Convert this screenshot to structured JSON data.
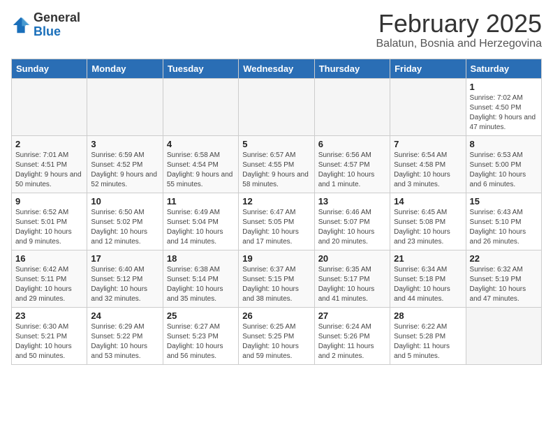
{
  "logo": {
    "general": "General",
    "blue": "Blue"
  },
  "title": "February 2025",
  "subtitle": "Balatun, Bosnia and Herzegovina",
  "weekdays": [
    "Sunday",
    "Monday",
    "Tuesday",
    "Wednesday",
    "Thursday",
    "Friday",
    "Saturday"
  ],
  "weeks": [
    [
      {
        "day": "",
        "info": ""
      },
      {
        "day": "",
        "info": ""
      },
      {
        "day": "",
        "info": ""
      },
      {
        "day": "",
        "info": ""
      },
      {
        "day": "",
        "info": ""
      },
      {
        "day": "",
        "info": ""
      },
      {
        "day": "1",
        "info": "Sunrise: 7:02 AM\nSunset: 4:50 PM\nDaylight: 9 hours and 47 minutes."
      }
    ],
    [
      {
        "day": "2",
        "info": "Sunrise: 7:01 AM\nSunset: 4:51 PM\nDaylight: 9 hours and 50 minutes."
      },
      {
        "day": "3",
        "info": "Sunrise: 6:59 AM\nSunset: 4:52 PM\nDaylight: 9 hours and 52 minutes."
      },
      {
        "day": "4",
        "info": "Sunrise: 6:58 AM\nSunset: 4:54 PM\nDaylight: 9 hours and 55 minutes."
      },
      {
        "day": "5",
        "info": "Sunrise: 6:57 AM\nSunset: 4:55 PM\nDaylight: 9 hours and 58 minutes."
      },
      {
        "day": "6",
        "info": "Sunrise: 6:56 AM\nSunset: 4:57 PM\nDaylight: 10 hours and 1 minute."
      },
      {
        "day": "7",
        "info": "Sunrise: 6:54 AM\nSunset: 4:58 PM\nDaylight: 10 hours and 3 minutes."
      },
      {
        "day": "8",
        "info": "Sunrise: 6:53 AM\nSunset: 5:00 PM\nDaylight: 10 hours and 6 minutes."
      }
    ],
    [
      {
        "day": "9",
        "info": "Sunrise: 6:52 AM\nSunset: 5:01 PM\nDaylight: 10 hours and 9 minutes."
      },
      {
        "day": "10",
        "info": "Sunrise: 6:50 AM\nSunset: 5:02 PM\nDaylight: 10 hours and 12 minutes."
      },
      {
        "day": "11",
        "info": "Sunrise: 6:49 AM\nSunset: 5:04 PM\nDaylight: 10 hours and 14 minutes."
      },
      {
        "day": "12",
        "info": "Sunrise: 6:47 AM\nSunset: 5:05 PM\nDaylight: 10 hours and 17 minutes."
      },
      {
        "day": "13",
        "info": "Sunrise: 6:46 AM\nSunset: 5:07 PM\nDaylight: 10 hours and 20 minutes."
      },
      {
        "day": "14",
        "info": "Sunrise: 6:45 AM\nSunset: 5:08 PM\nDaylight: 10 hours and 23 minutes."
      },
      {
        "day": "15",
        "info": "Sunrise: 6:43 AM\nSunset: 5:10 PM\nDaylight: 10 hours and 26 minutes."
      }
    ],
    [
      {
        "day": "16",
        "info": "Sunrise: 6:42 AM\nSunset: 5:11 PM\nDaylight: 10 hours and 29 minutes."
      },
      {
        "day": "17",
        "info": "Sunrise: 6:40 AM\nSunset: 5:12 PM\nDaylight: 10 hours and 32 minutes."
      },
      {
        "day": "18",
        "info": "Sunrise: 6:38 AM\nSunset: 5:14 PM\nDaylight: 10 hours and 35 minutes."
      },
      {
        "day": "19",
        "info": "Sunrise: 6:37 AM\nSunset: 5:15 PM\nDaylight: 10 hours and 38 minutes."
      },
      {
        "day": "20",
        "info": "Sunrise: 6:35 AM\nSunset: 5:17 PM\nDaylight: 10 hours and 41 minutes."
      },
      {
        "day": "21",
        "info": "Sunrise: 6:34 AM\nSunset: 5:18 PM\nDaylight: 10 hours and 44 minutes."
      },
      {
        "day": "22",
        "info": "Sunrise: 6:32 AM\nSunset: 5:19 PM\nDaylight: 10 hours and 47 minutes."
      }
    ],
    [
      {
        "day": "23",
        "info": "Sunrise: 6:30 AM\nSunset: 5:21 PM\nDaylight: 10 hours and 50 minutes."
      },
      {
        "day": "24",
        "info": "Sunrise: 6:29 AM\nSunset: 5:22 PM\nDaylight: 10 hours and 53 minutes."
      },
      {
        "day": "25",
        "info": "Sunrise: 6:27 AM\nSunset: 5:23 PM\nDaylight: 10 hours and 56 minutes."
      },
      {
        "day": "26",
        "info": "Sunrise: 6:25 AM\nSunset: 5:25 PM\nDaylight: 10 hours and 59 minutes."
      },
      {
        "day": "27",
        "info": "Sunrise: 6:24 AM\nSunset: 5:26 PM\nDaylight: 11 hours and 2 minutes."
      },
      {
        "day": "28",
        "info": "Sunrise: 6:22 AM\nSunset: 5:28 PM\nDaylight: 11 hours and 5 minutes."
      },
      {
        "day": "",
        "info": ""
      }
    ]
  ]
}
